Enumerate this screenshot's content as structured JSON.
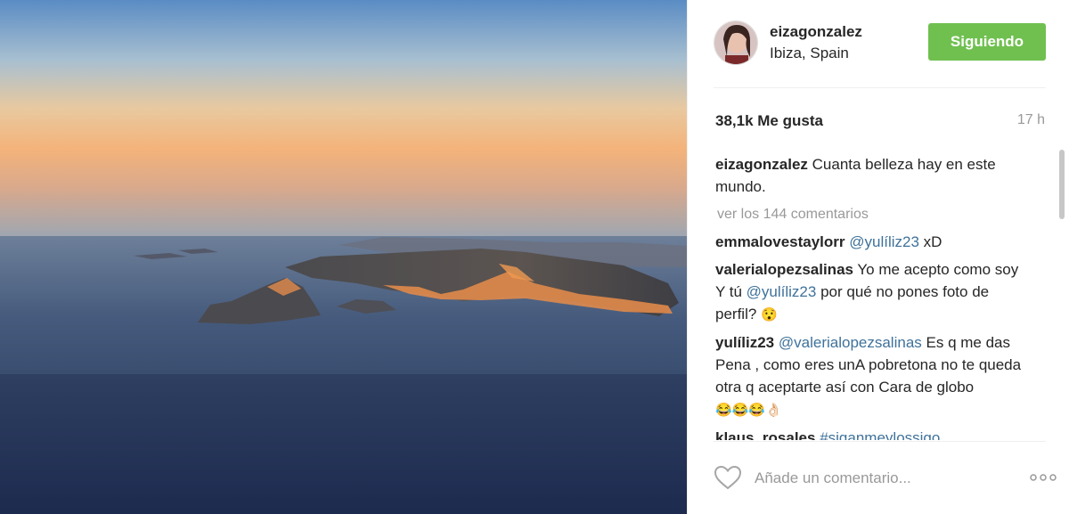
{
  "post": {
    "image_alt": "Aerial photo of Es Vedrà island and Ibiza coastline at sunset"
  },
  "header": {
    "username": "eizagonzalez",
    "location": "Ibiza, Spain",
    "follow_label": "Siguiendo"
  },
  "stats": {
    "likes": "38,1k Me gusta",
    "time": "17 h"
  },
  "caption": {
    "user": "eizagonzalez",
    "text": " Cuanta belleza hay en este mundo."
  },
  "view_all": "ver los 144 comentarios",
  "comments": [
    {
      "user": "emmalovestaylorr",
      "pre": " ",
      "mention": "@yulíliz23",
      "post": " xD",
      "emoji": ""
    },
    {
      "user": "valerialopezsalinas",
      "pre": " Yo me acepto como soy Y tú ",
      "mention": "@yulíliz23",
      "post": " por qué no pones foto de perfil? ",
      "emoji": "😯"
    },
    {
      "user": "yulíliz23",
      "pre": " ",
      "mention": "@valerialopezsalinas",
      "post": " Es q me das Pena , como eres unA pobretona no te queda otra q aceptarte así con Cara de globo ",
      "emoji": "😂😂😂👌🏻"
    },
    {
      "user": "klaus_rosales",
      "pre": " ",
      "mention": "#siganmeylossigo",
      "post": "",
      "emoji": ""
    }
  ],
  "add_comment": {
    "placeholder": "Añade un comentario..."
  },
  "icons": {
    "heart": "heart-outline-icon",
    "more": "more-options-icon"
  },
  "colors": {
    "follow_button": "#70c050",
    "mention": "#3f729b",
    "muted": "#999999"
  }
}
